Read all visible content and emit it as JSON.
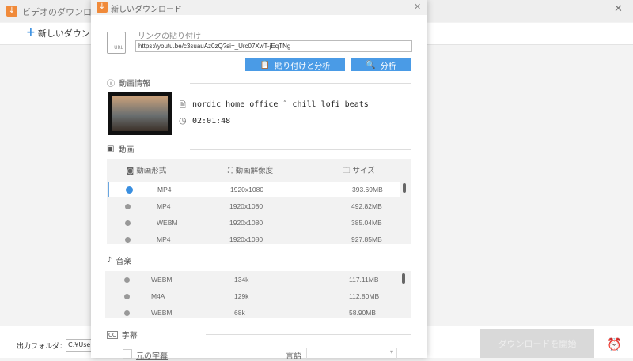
{
  "main": {
    "title": "ビデオのダウンロ",
    "new_download": "新しいダウンロ",
    "output_label": "出力フォルダ：",
    "output_path": "C:¥Users",
    "start_button": "ダウンロードを開始"
  },
  "dialog": {
    "title": "新しいダウンロード",
    "paste_label": "リンクの貼り付け",
    "url": "https://youtu.be/c3suauAz0zQ?si=_Urc07XwT-jEqTNg",
    "paste_analyze": "貼り付けと分析",
    "analyze": "分析",
    "info_section": "動画情報",
    "video_title": "nordic home office ˜ chill lofi beats",
    "duration": "02:01:48",
    "video_section": "動画",
    "video_headers": [
      "動画形式",
      "動画解像度",
      "サイズ"
    ],
    "video_rows": [
      {
        "format": "MP4",
        "res": "1920x1080",
        "size": "393.69MB",
        "selected": true
      },
      {
        "format": "MP4",
        "res": "1920x1080",
        "size": "492.82MB"
      },
      {
        "format": "WEBM",
        "res": "1920x1080",
        "size": "385.04MB"
      },
      {
        "format": "MP4",
        "res": "1920x1080",
        "size": "927.85MB"
      }
    ],
    "audio_section": "音楽",
    "audio_rows": [
      {
        "format": "WEBM",
        "bitrate": "134k",
        "size": "117.11MB"
      },
      {
        "format": "M4A",
        "bitrate": "129k",
        "size": "112.80MB"
      },
      {
        "format": "WEBM",
        "bitrate": "68k",
        "size": "58.90MB"
      }
    ],
    "subtitle_section": "字幕",
    "original_subtitle": "元の字幕",
    "language_label": "言語"
  },
  "colors": {
    "accent": "#4a9be6",
    "logo": "#f08a3a"
  }
}
